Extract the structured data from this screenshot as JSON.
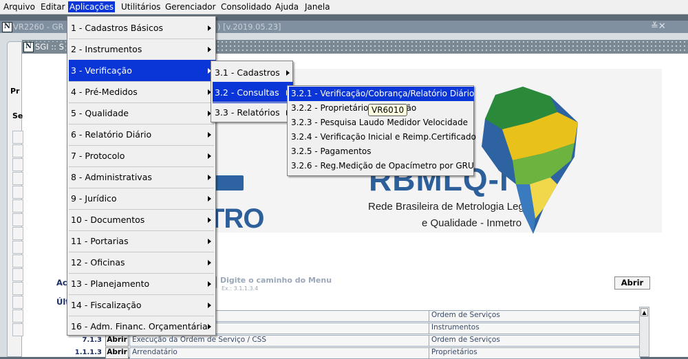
{
  "menubar": {
    "items": [
      {
        "label": "Arquivo"
      },
      {
        "label": "Editar"
      },
      {
        "label": "Aplicações"
      },
      {
        "label": "Utilitários"
      },
      {
        "label": "Gerenciador"
      },
      {
        "label": "Consolidado"
      },
      {
        "label": "Ajuda"
      },
      {
        "label": "Janela"
      }
    ]
  },
  "outer_window": {
    "title_start": "VR2260 - GR",
    "title_end": ") [v.2019.05.23]",
    "controls": "≚✕"
  },
  "inner_window": {
    "title": "SGI :: S"
  },
  "form": {
    "label_pr": "Pr",
    "label_se": "Se",
    "menu_path_placeholder": "Digite o caminho do Menu",
    "menu_path_example": "Ex.: 3.1.1.3.4",
    "abrir_button": "Abrir",
    "acc_label": "Ac",
    "ult_label": "Últ"
  },
  "banner": {
    "title": "RBMLQ-I",
    "line1": "Rede Brasileira de Metrologia Legal",
    "line2": "e Qualidade - Inmetro",
    "partial_logo": "TRO"
  },
  "recent": {
    "rows": [
      {
        "code": "",
        "button": "",
        "desc": "",
        "category": "Ordem de Serviços"
      },
      {
        "code": "",
        "button": "",
        "desc": "",
        "category": "Instrumentos"
      },
      {
        "code": "7.1.3",
        "button": "Abrir",
        "desc": "Execução da Ordem de Serviço / CSS",
        "category": "Ordem de Serviços"
      },
      {
        "code": "1.1.1.3",
        "button": "Abrir",
        "desc": "Arrendatário",
        "category": "Proprietários"
      }
    ]
  },
  "menu_aplicacoes": {
    "items": [
      {
        "label": "1 - Cadastros Básicos"
      },
      {
        "label": "2 - Instrumentos"
      },
      {
        "label": "3 - Verificação"
      },
      {
        "label": "4 - Pré-Medidos"
      },
      {
        "label": "5 - Qualidade"
      },
      {
        "label": "6 - Relatório Diário"
      },
      {
        "label": "7 - Protocolo"
      },
      {
        "label": "8 - Administrativas"
      },
      {
        "label": "9 - Jurídico"
      },
      {
        "label": "10 - Documentos"
      },
      {
        "label": "11 - Portarias"
      },
      {
        "label": "12 - Oficinas"
      },
      {
        "label": "13 - Planejamento"
      },
      {
        "label": "14 - Fiscalização"
      },
      {
        "label": "16 - Adm. Financ. Orçamentária"
      }
    ]
  },
  "menu_verificacao": {
    "items": [
      {
        "label": "3.1 - Cadastros"
      },
      {
        "label": "3.2 - Consultas"
      },
      {
        "label": "3.3 - Relatórios"
      }
    ]
  },
  "menu_consultas": {
    "items": [
      {
        "label": "3.2.1 - Verificação/Cobrança/Relatório Diário"
      },
      {
        "label": "3.2.2 - Proprietário/Verificação"
      },
      {
        "label": "3.2.3 - Pesquisa Laudo Medidor Velocidade"
      },
      {
        "label": "3.2.4 - Verificação Inicial e Reimp.Certificado"
      },
      {
        "label": "3.2.5 - Pagamentos"
      },
      {
        "label": "3.2.6 - Reg.Medição de Opacímetro por GRU"
      }
    ]
  },
  "tooltip": {
    "text": "VR6010"
  },
  "colors": {
    "menu_highlight": "#0a36d8",
    "menu_bg": "#f0f0f0",
    "tooltip_bg": "#ffffe1"
  }
}
